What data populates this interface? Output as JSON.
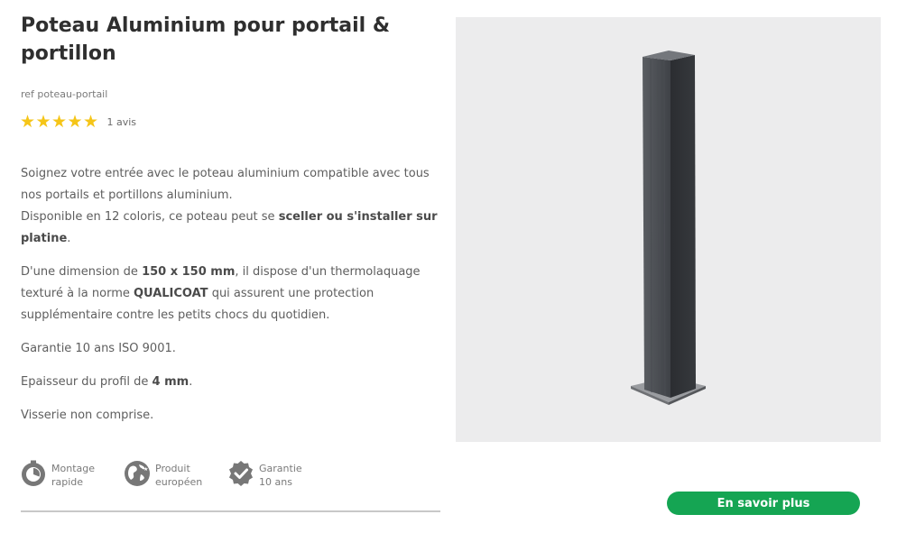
{
  "product": {
    "title": "Poteau Aluminium pour portail & portillon",
    "ref": "ref poteau-portail",
    "rating": 5,
    "reviews": "1 avis"
  },
  "description": {
    "p1_a": "Soignez votre entrée avec le poteau aluminium compatible avec tous nos portails et portillons aluminium.",
    "p1_b": "Disponible en 12 coloris, ce poteau peut se ",
    "p1_b_bold": "sceller ou s'installer sur platine",
    "p1_b_end": ".",
    "p2_a": "D'une dimension de ",
    "p2_bold1": "150 x 150 mm",
    "p2_b": ", il dispose d'un thermolaquage texturé à la norme ",
    "p2_bold2": "QUALICOAT",
    "p2_c": " qui assurent une protection supplémentaire contre les petits chocs du quotidien.",
    "p3": "Garantie 10 ans ISO 9001.",
    "p4_a": "Epaisseur du profil de ",
    "p4_bold": "4 mm",
    "p4_end": ".",
    "p5": "Visserie non comprise."
  },
  "features": [
    {
      "icon": "timer-icon",
      "line1": "Montage",
      "line2": "rapide"
    },
    {
      "icon": "globe-europe-icon",
      "line1": "Produit",
      "line2": "européen"
    },
    {
      "icon": "badge-check-icon",
      "line1": "Garantie",
      "line2": "10 ans"
    }
  ],
  "cta": {
    "label": "En savoir plus"
  },
  "colors": {
    "accent": "#15a553",
    "star": "#f5c518",
    "post": "#3c3e42",
    "panel_bg": "#ececed"
  }
}
